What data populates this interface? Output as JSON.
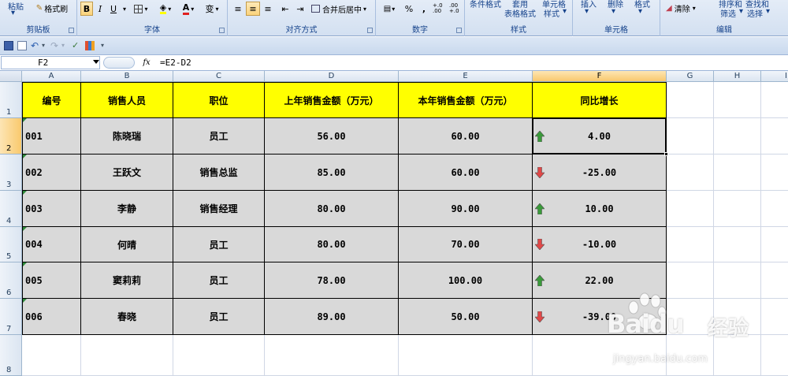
{
  "ribbon": {
    "clipboard": {
      "paste": "粘贴",
      "format_painter": "格式刷",
      "label": "剪贴板"
    },
    "font": {
      "bold": "B",
      "italic": "I",
      "underline": "U",
      "wen": "变",
      "label": "字体"
    },
    "alignment": {
      "merge_center": "合并后居中",
      "label": "对齐方式"
    },
    "number": {
      "percent": "%",
      "comma": ",",
      "inc_decimal": "+.0 .00",
      "dec_decimal": ".00 +.0",
      "label": "数字"
    },
    "styles": {
      "conditional": "条件格式",
      "table_format_top": "套用",
      "table_format": "表格格式",
      "cell_style_top": "单元格",
      "cell_style": "样式",
      "label": "样式"
    },
    "cells": {
      "insert": "插入",
      "delete": "删除",
      "format": "格式",
      "label": "单元格"
    },
    "editing": {
      "clear": "清除",
      "sort_top": "排序和",
      "sort": "筛选",
      "find_top": "查找和",
      "find": "选择",
      "label": "编辑"
    }
  },
  "formula_bar": {
    "name_box": "F2",
    "fx": "fx",
    "formula": "=E2-D2"
  },
  "columns": [
    "A",
    "B",
    "C",
    "D",
    "E",
    "F",
    "G",
    "H",
    "I"
  ],
  "rows": [
    "1",
    "2",
    "3",
    "4",
    "5",
    "6",
    "7",
    "8"
  ],
  "headers": [
    "编号",
    "销售人员",
    "职位",
    "上年销售金额（万元）",
    "本年销售金额（万元）",
    "同比增长"
  ],
  "data": [
    {
      "id": "001",
      "name": "陈晓瑞",
      "title": "员工",
      "last": "56.00",
      "this": "60.00",
      "growth": "4.00",
      "dir": "up"
    },
    {
      "id": "002",
      "name": "王跃文",
      "title": "销售总监",
      "last": "85.00",
      "this": "60.00",
      "growth": "-25.00",
      "dir": "down"
    },
    {
      "id": "003",
      "name": "李静",
      "title": "销售经理",
      "last": "80.00",
      "this": "90.00",
      "growth": "10.00",
      "dir": "up"
    },
    {
      "id": "004",
      "name": "何晴",
      "title": "员工",
      "last": "80.00",
      "this": "70.00",
      "growth": "-10.00",
      "dir": "down"
    },
    {
      "id": "005",
      "name": "窦莉莉",
      "title": "员工",
      "last": "78.00",
      "this": "100.00",
      "growth": "22.00",
      "dir": "up"
    },
    {
      "id": "006",
      "name": "春晓",
      "title": "员工",
      "last": "89.00",
      "this": "50.00",
      "growth": "-39.00",
      "dir": "down"
    }
  ],
  "colors": {
    "header_fill": "#ffff00",
    "body_fill": "#d9d9d9",
    "up_arrow": "#3a9a3a",
    "down_arrow": "#e04848"
  },
  "watermark": {
    "brand": "Baidu",
    "cn": "经验",
    "url": "jingyan.baidu.com"
  }
}
